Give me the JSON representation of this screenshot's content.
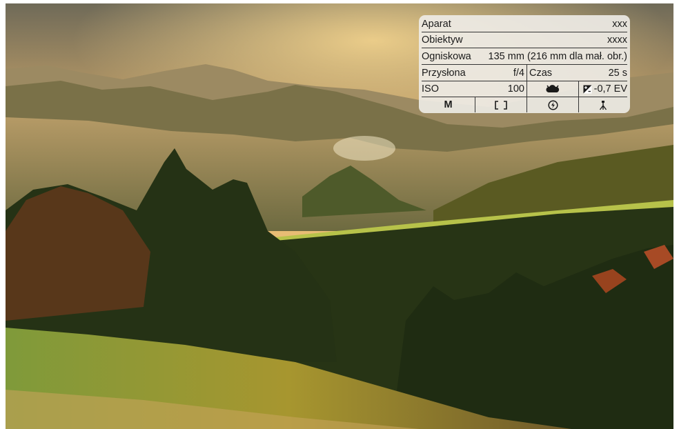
{
  "image": {
    "description_colors": {
      "sky": "#d9b06a",
      "forest": "#2b3a1c",
      "grass": "#9aa845"
    }
  },
  "exif": {
    "camera": {
      "label": "Aparat",
      "value": "xxx"
    },
    "lens": {
      "label": "Obiektyw",
      "value": "xxxx"
    },
    "focal": {
      "label": "Ogniskowa",
      "value": "135 mm (216 mm dla mał. obr.)"
    },
    "aperture": {
      "label": "Przysłona",
      "value": "f/4"
    },
    "shutter": {
      "label": "Czas",
      "value": "25 s"
    },
    "iso": {
      "label": "ISO",
      "value": "100"
    },
    "white_balance_icon": "cloudy-wb-icon",
    "exposure_comp": {
      "icon": "exposure-compensation-icon",
      "value": "-0,7 EV"
    },
    "mode": {
      "label": "M"
    },
    "metering_icon": "metering-frame-icon",
    "flash_icon": "flash-off-icon",
    "stabilization_icon": "tripod-icon"
  }
}
